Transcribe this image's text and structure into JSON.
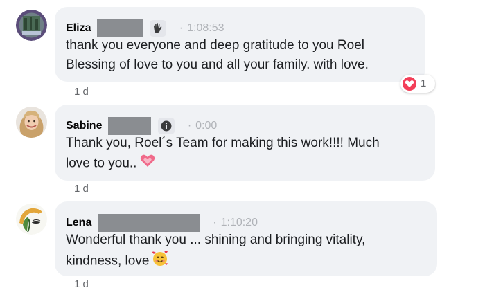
{
  "comments": [
    {
      "name": "Eliza",
      "timestamp": "1:08:53",
      "lines": [
        "thank you everyone and deep gratitude to you Roel",
        "Blessing of love to you and all your family. with love."
      ],
      "time_ago": "1 d",
      "badge_icon": "wave-hand-icon",
      "reaction": {
        "type": "love",
        "count": "1",
        "color": "#f33e58"
      }
    },
    {
      "name": "Sabine",
      "timestamp": "0:00",
      "lines": [
        "Thank you, Roel´s Team for making this work!!!! Much",
        "love to you.."
      ],
      "time_ago": "1 d",
      "badge_icon": "info-icon",
      "emoji": "sparkling-heart-emoji"
    },
    {
      "name": "Lena",
      "timestamp": "1:10:20",
      "lines": [
        "Wonderful thank you ... shining and bringing vitality,",
        "kindness, love"
      ],
      "time_ago": "1 d",
      "emoji": "smiling-face-with-hearts-emoji"
    }
  ],
  "separator": "·",
  "colors": {
    "bubble": "#f0f2f5",
    "timestamp": "#b0b3b8",
    "meta": "#65676b",
    "redaction": "#8a8d91"
  }
}
